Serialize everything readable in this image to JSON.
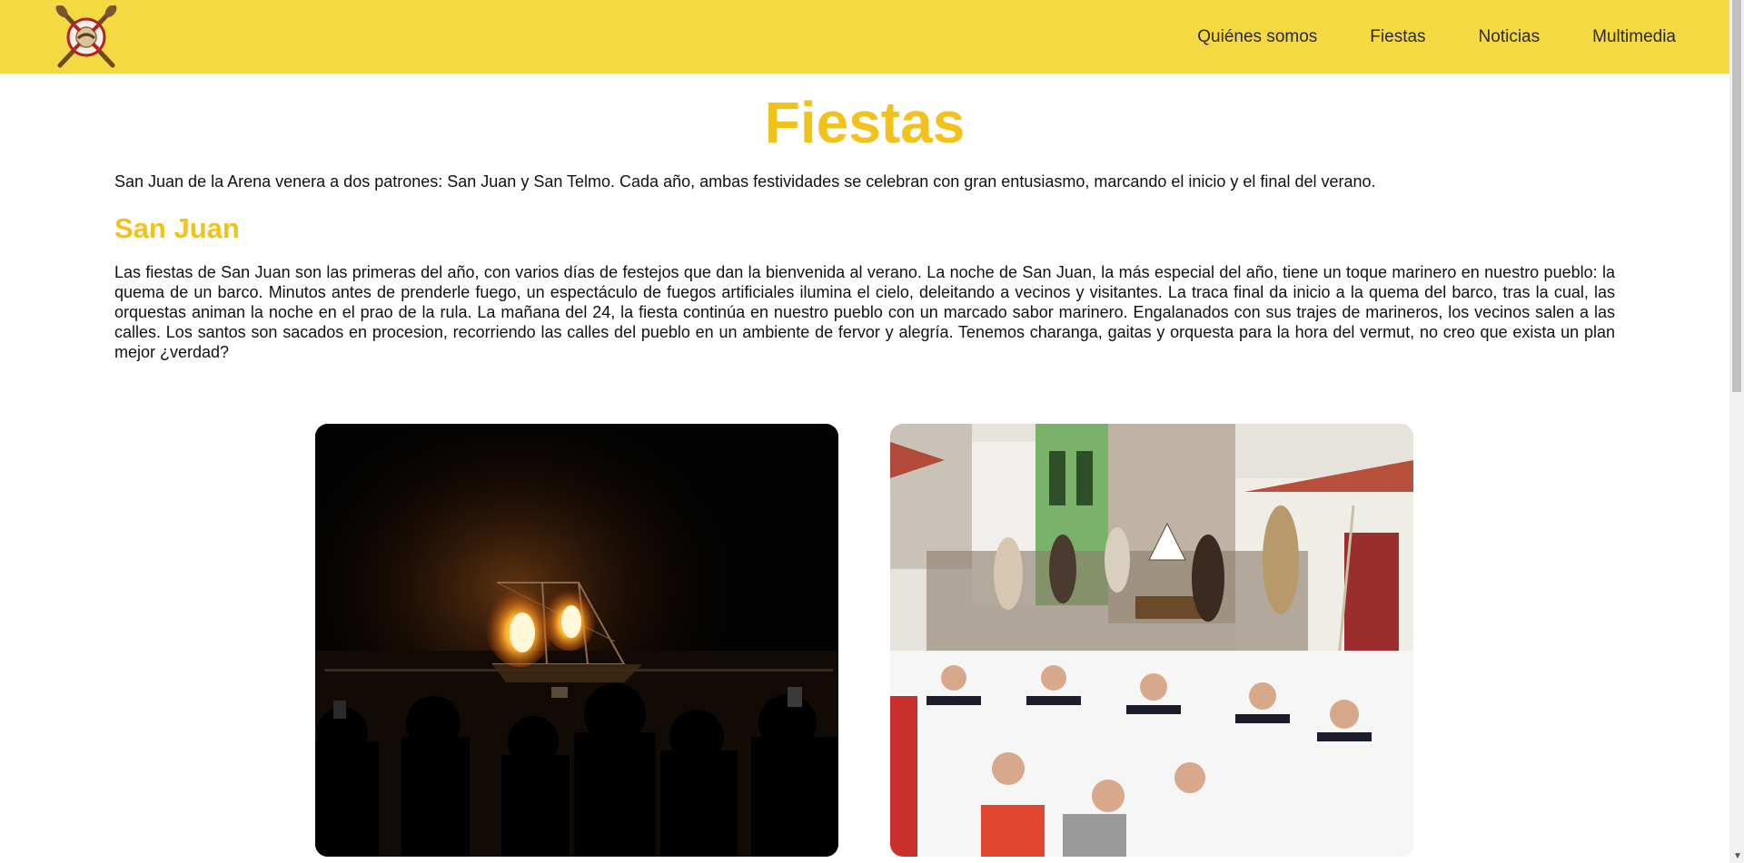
{
  "nav": {
    "items": [
      {
        "label": "Quiénes somos"
      },
      {
        "label": "Fiestas"
      },
      {
        "label": "Noticias"
      },
      {
        "label": "Multimedia"
      }
    ]
  },
  "page": {
    "title": "Fiestas",
    "intro": "San Juan de la Arena venera a dos patrones: San Juan y San Telmo. Cada año, ambas festividades se celebran con gran entusiasmo, marcando el inicio y el final del verano."
  },
  "section": {
    "title": "San Juan",
    "text": "Las fiestas de San Juan son las primeras del año, con varios días de festejos que dan la bienvenida al verano. La noche de San Juan, la más especial del año, tiene un toque marinero en nuestro pueblo: la quema de un barco. Minutos antes de prenderle fuego, un espectáculo de fuegos artificiales ilumina el cielo, deleitando a vecinos y visitantes. La traca final da inicio a la quema del barco, tras la cual, las orquestas animan la noche en el prao de la rula. La mañana del 24, la fiesta continúa en nuestro pueblo con un marcado sabor marinero. Engalanados con sus trajes de marineros, los vecinos salen a las calles. Los santos son sacados en procesion, recorriendo las calles del pueblo en un ambiente de fervor y alegría. Tenemos charanga, gaitas y orquesta para la hora del vermut, no creo que exista un plan mejor ¿verdad?"
  },
  "colors": {
    "header": "#f5d942",
    "accent": "#f2c21a"
  },
  "icons": {
    "logo": "crossed-oars-emblem-icon"
  }
}
